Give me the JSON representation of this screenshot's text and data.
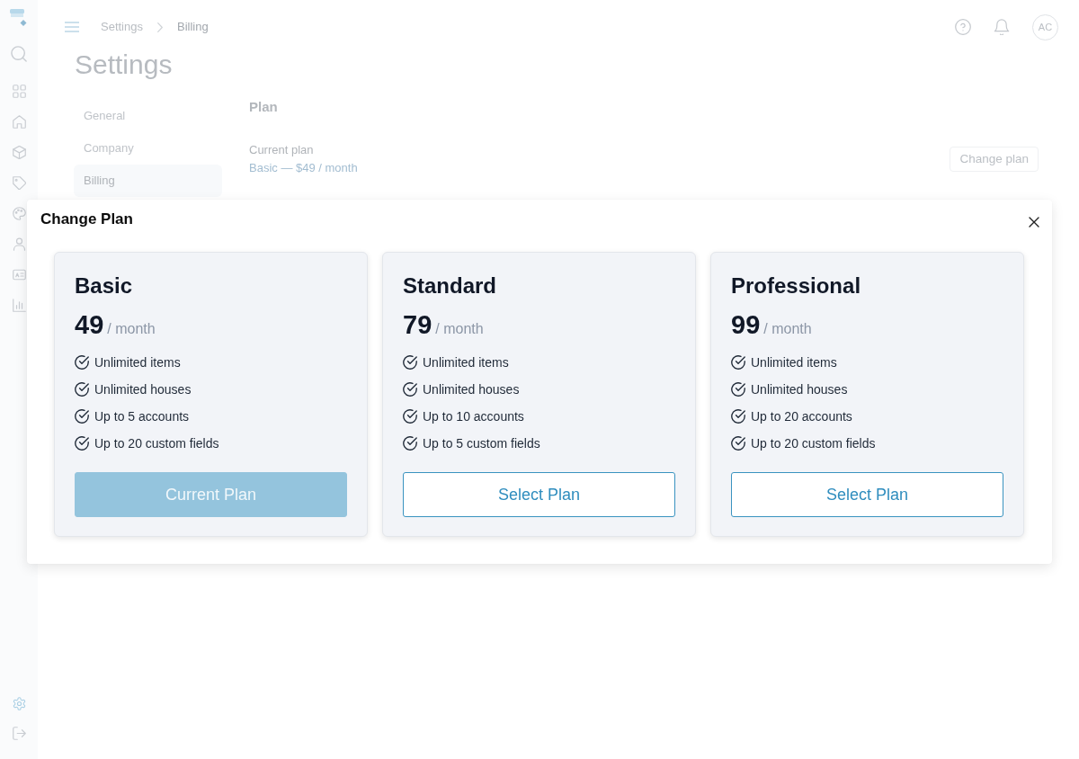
{
  "sidebar": {
    "items": [
      {
        "selected": false
      },
      {
        "selected": false
      },
      {
        "selected": false
      },
      {
        "selected": false
      },
      {
        "selected": false
      },
      {
        "selected": false
      },
      {
        "selected": false
      },
      {
        "selected": false
      },
      {
        "selected": false
      }
    ],
    "footer_items": [
      {
        "selected": true
      },
      {
        "selected": false
      }
    ]
  },
  "header": {
    "breadcrumb": [
      "Settings",
      "Billing"
    ],
    "avatar_initials": "AC"
  },
  "page": {
    "title": "Settings",
    "settings_nav": [
      {
        "label": "General",
        "selected": false
      },
      {
        "label": "Company",
        "selected": false
      },
      {
        "label": "Billing",
        "selected": true
      }
    ],
    "plan_section": {
      "heading": "Plan",
      "label": "Current plan",
      "value": "Basic — $49 / month",
      "button": "Change plan"
    }
  },
  "modal": {
    "title": "Change Plan",
    "plans": [
      {
        "name": "Basic",
        "price": "49",
        "period": "/ month",
        "features": [
          "Unlimited items",
          "Unlimited houses",
          "Up to 5 accounts",
          "Up to 20 custom fields"
        ],
        "button": "Current Plan",
        "current": true
      },
      {
        "name": "Standard",
        "price": "79",
        "period": "/ month",
        "features": [
          "Unlimited items",
          "Unlimited houses",
          "Up to 10 accounts",
          "Up to 5 custom fields"
        ],
        "button": "Select Plan",
        "current": false
      },
      {
        "name": "Professional",
        "price": "99",
        "period": "/ month",
        "features": [
          "Unlimited items",
          "Unlimited houses",
          "Up to 20 accounts",
          "Up to 20 custom fields"
        ],
        "button": "Select Plan",
        "current": false
      }
    ]
  }
}
